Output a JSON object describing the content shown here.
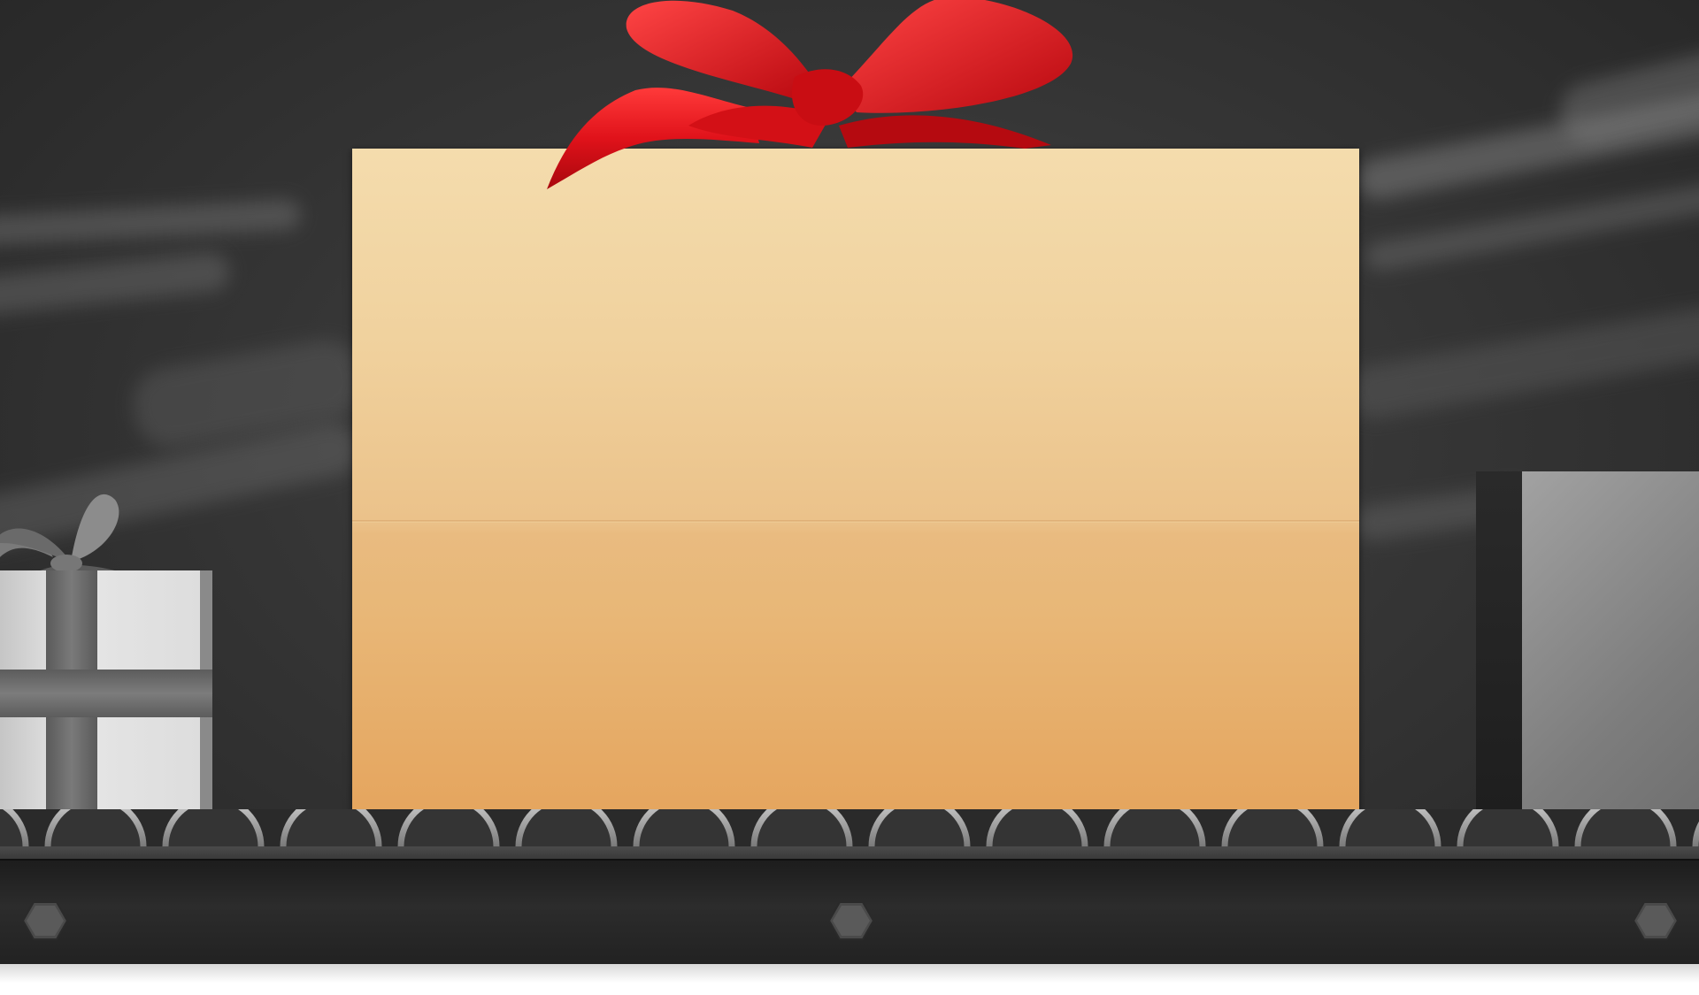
{
  "scene": {
    "card": {
      "text": ""
    },
    "background_colors": [
      "#262626",
      "#4a4a4a"
    ],
    "card_colors": [
      "#f4dcad",
      "#e5a55e"
    ],
    "bow_color": "#d8141a"
  },
  "icons": {
    "left_gift": "gift-box-icon",
    "right_gift": "box-icon",
    "bow": "ribbon-bow-icon",
    "bolts": "hex-bolt-icon"
  }
}
